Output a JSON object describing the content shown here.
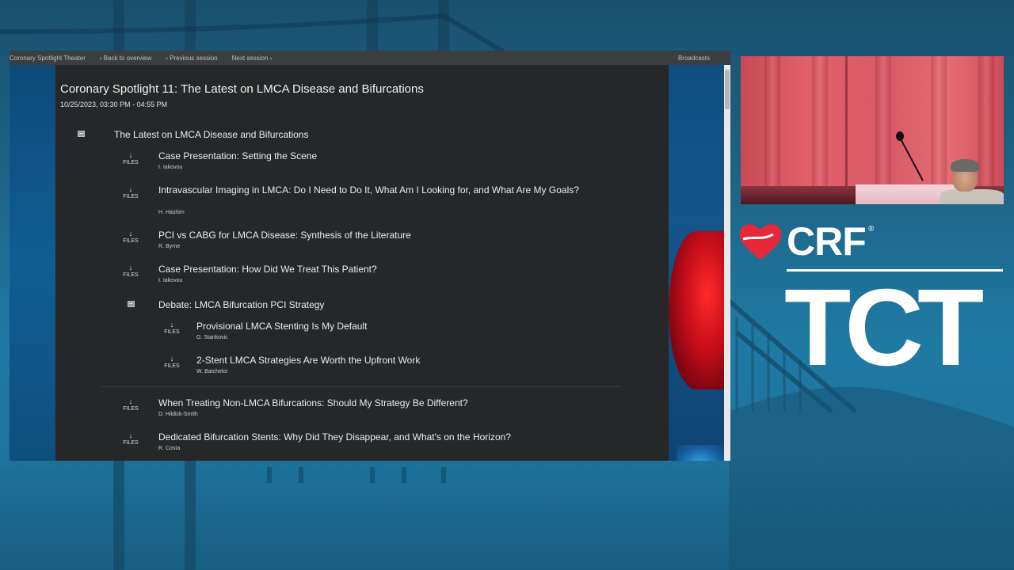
{
  "topbar": {
    "theater": "Coronary Spotlight Theater",
    "back": "‹ Back to overview",
    "previous": "‹ Previous session",
    "next": "Next session ›",
    "broadcasts": "Broadcasts"
  },
  "session": {
    "title": "Coronary Spotlight 11: The Latest on LMCA Disease and Bifurcations",
    "datetime": "10/25/2023, 03:30 PM - 04:55 PM"
  },
  "files_label": "FILES",
  "group": {
    "title": "The Latest on LMCA Disease and Bifurcations"
  },
  "items": [
    {
      "title": "Case Presentation: Setting the Scene",
      "speaker": "I. Iakovou"
    },
    {
      "title": "Intravascular Imaging in LMCA: Do I Need to Do It, What Am I Looking for, and What Are My Goals?",
      "speaker": "H. Hashim"
    },
    {
      "title": "PCI vs CABG for LMCA Disease: Synthesis of the Literature",
      "speaker": "R. Byrne"
    },
    {
      "title": "Case Presentation: How Did We Treat This Patient?",
      "speaker": "I. Iakovou"
    }
  ],
  "debate": {
    "title": "Debate: LMCA Bifurcation PCI Strategy",
    "items": [
      {
        "title": "Provisional LMCA Stenting Is My Default",
        "speaker": "G. Stankovic"
      },
      {
        "title": "2-Stent LMCA Strategies Are Worth the Upfront Work",
        "speaker": "W. Batchelor"
      }
    ]
  },
  "later_items": [
    {
      "title": "When Treating Non-LMCA Bifurcations: Should My Strategy Be Different?",
      "speaker": "D. Hildick-Smith"
    },
    {
      "title": "Dedicated Bifurcation Stents: Why Did They Disappear, and What's on the Horizon?",
      "speaker": "R. Costa"
    }
  ],
  "branding": {
    "crf": "CRF",
    "registered": "®",
    "tct": "TCT",
    "heart_color": "#e8283a"
  }
}
